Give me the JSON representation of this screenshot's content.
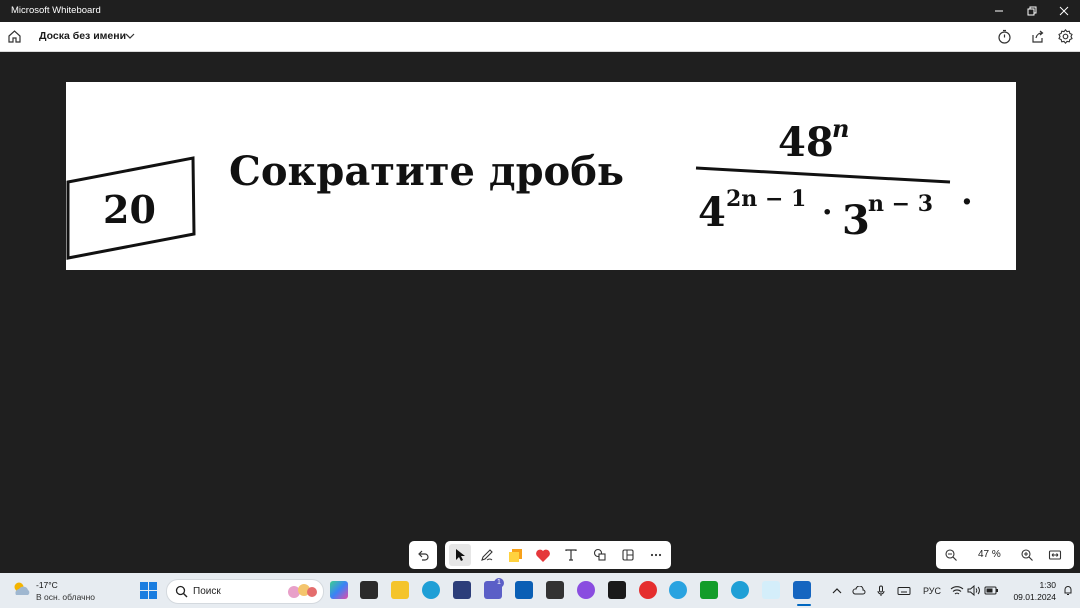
{
  "window": {
    "title": "Microsoft Whiteboard"
  },
  "appbar": {
    "board_name": "Доска без имени"
  },
  "content": {
    "problem_number": "20",
    "problem_text": "Сократите дробь",
    "numerator_base": "48",
    "numerator_exp": "n",
    "denominator": {
      "base1": "4",
      "exp1": "2n − 1",
      "dot": "·",
      "base2": "3",
      "exp2": "n − 3"
    },
    "trailing": "."
  },
  "toolbar": {
    "undo": "undo-icon",
    "tools": [
      "select-icon",
      "pen-icon",
      "sticky-note-icon",
      "heart-icon",
      "text-icon",
      "shapes-icon",
      "template-icon",
      "more-icon"
    ]
  },
  "zoom": {
    "value": "47 %"
  },
  "taskbar": {
    "weather_temp": "-17°C",
    "weather_desc": "В осн. облачно",
    "search_placeholder": "Поиск",
    "language": "РУС",
    "time": "1:30",
    "date": "09.01.2024",
    "teams_badge": "1"
  },
  "colors": {
    "canvas": "#1f1f1f",
    "accent": "#0067c0"
  }
}
